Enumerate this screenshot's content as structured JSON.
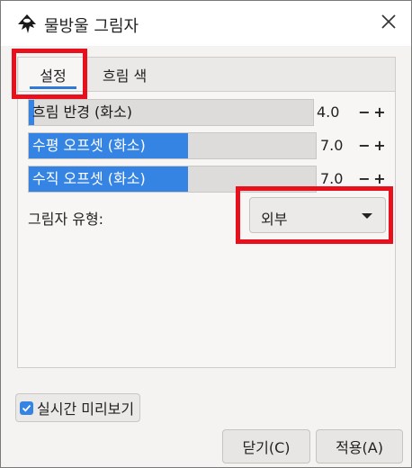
{
  "window": {
    "title": "물방울 그림자",
    "app_icon": "inkscape-logo-icon",
    "close_icon": "close-icon"
  },
  "tabs": [
    {
      "label": "설정",
      "active": true
    },
    {
      "label": "흐림 색",
      "active": false
    }
  ],
  "sliders": [
    {
      "label": "흐림 반경 (화소)",
      "value_text": "4.0",
      "value": 4.0,
      "max": 200,
      "fill_fraction": 0.02
    },
    {
      "label": "수평 오프셋 (화소)",
      "value_text": "7.0",
      "value": 7.0,
      "fill_fraction": 0.55
    },
    {
      "label": "수직 오프셋 (화소)",
      "value_text": "7.0",
      "value": 7.0,
      "fill_fraction": 0.55
    }
  ],
  "stepper": {
    "minus": "−",
    "plus": "+"
  },
  "shadow_type": {
    "label": "그림자 유형:",
    "selected": "외부"
  },
  "live_preview": {
    "label": "실시간 미리보기",
    "checked": true
  },
  "buttons": {
    "close": "닫기(C)",
    "apply": "적용(A)"
  },
  "colors": {
    "accent": "#3584e4",
    "highlight": "#e8101d"
  }
}
